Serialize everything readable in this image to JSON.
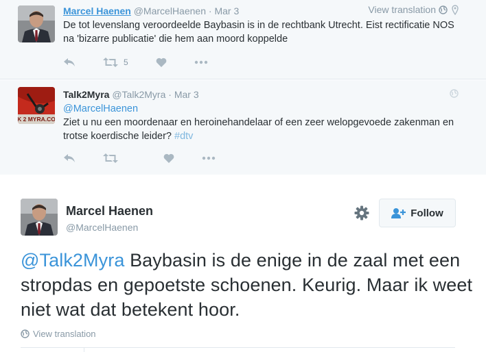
{
  "reply1": {
    "fullname": "Marcel Haenen",
    "username": "@MarcelHaenen",
    "separator": "·",
    "date": "Mar 3",
    "view_translation": "View translation",
    "text": "De tot levenslang veroordeelde Baybasin is in de rechtbank Utrecht. Eist rectificatie NOS na 'bizarre publicatie' die hem aan moord koppelde",
    "retweet_count": "5",
    "icons": [
      "reply-icon",
      "retweet-icon",
      "heart-icon",
      "more-icon",
      "globe-icon",
      "location-pin-icon"
    ]
  },
  "reply2": {
    "fullname": "Talk2Myra",
    "username": "@Talk2Myra",
    "separator": "·",
    "date": "Mar 3",
    "mention": "@MarcelHaenen",
    "text": "Ziet u nu een moordenaar en heroinehandelaar of een zeer welopgevoede zakenman en trotse koerdische leider?",
    "hashtag": "#dtv",
    "avatar_text": "K 2 MYRA.CO",
    "icons": [
      "reply-icon",
      "retweet-icon",
      "heart-icon",
      "more-icon",
      "globe-icon"
    ]
  },
  "main": {
    "fullname": "Marcel Haenen",
    "username": "@MarcelHaenen",
    "follow_label": "Follow",
    "mention": "@Talk2Myra",
    "text": "Baybasin is de enige in de zaal met een stropdas en gepoetste schoenen. Keurig. Maar ik weet niet wat dat betekent hoor.",
    "view_translation": "View translation",
    "icons": [
      "gear-icon",
      "follow-user-icon",
      "globe-icon"
    ]
  },
  "colors": {
    "link": "#3b94d9",
    "muted": "#8899a6",
    "reply_bg": "#f5f8fa",
    "text": "#292f33"
  }
}
